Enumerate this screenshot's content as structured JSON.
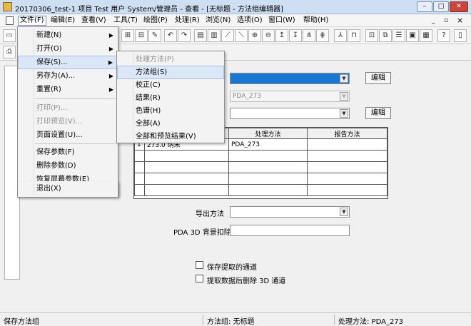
{
  "window": {
    "title": "20170306_test-1 项目 Test 用户 System/管理员 - 查看 - [无标题 - 方法组编辑器]",
    "controls": {
      "minimize": "–",
      "restore": "□",
      "close": "✕"
    },
    "mdi_controls": {
      "minimize": "_",
      "restore": "▫",
      "close": "×"
    }
  },
  "menubar": {
    "items": [
      {
        "label": "文件(F)",
        "active": true
      },
      {
        "label": "编辑(E)"
      },
      {
        "label": "查看(V)"
      },
      {
        "label": "工具(T)"
      },
      {
        "label": "绘图(P)"
      },
      {
        "label": "处理(R)"
      },
      {
        "label": "浏览(N)"
      },
      {
        "label": "选项(O)"
      },
      {
        "label": "窗口(W)"
      },
      {
        "label": "帮助(H)"
      }
    ]
  },
  "file_menu": {
    "items": [
      {
        "label": "新建(N)",
        "submenu": true
      },
      {
        "label": "打开(O)",
        "submenu": true
      },
      {
        "label": "保存(S)...",
        "submenu": true,
        "highlighted": true
      },
      {
        "label": "另存为(A)...",
        "submenu": true
      },
      {
        "label": "重置(R)",
        "submenu": true
      },
      {
        "label": "打印(P)...",
        "disabled": true
      },
      {
        "label": "打印预览(V)...",
        "disabled": true
      },
      {
        "label": "页面设置(U)..."
      },
      {
        "label": "保存参数(F)"
      },
      {
        "label": "删除参数(D)"
      },
      {
        "label": "恢复屏幕参数(E)"
      },
      {
        "label": "退出(X)"
      }
    ],
    "submenu_arrow": "▶"
  },
  "save_submenu": {
    "items": [
      {
        "label": "处理方法(P)",
        "disabled": true
      },
      {
        "label": "方法组(S)",
        "highlighted": true
      },
      {
        "label": "校正(C)"
      },
      {
        "label": "结果(R)"
      },
      {
        "label": "色谱(H)"
      },
      {
        "label": "全部(A)"
      },
      {
        "label": "全部和预览结果(V)"
      }
    ]
  },
  "form": {
    "edit_button_1": "编辑",
    "edit_button_2": "编辑",
    "combo2_value": "PDA_273",
    "combo_arrow": "▼",
    "table": {
      "headers": [
        "",
        "",
        "处理方法",
        "报告方法"
      ],
      "rows": [
        [
          "1",
          "273.0 纳米",
          "PDA_273",
          ""
        ],
        [
          "",
          "",
          "",
          ""
        ],
        [
          "",
          "",
          "",
          ""
        ],
        [
          "",
          "",
          "",
          ""
        ],
        [
          "",
          "",
          "",
          ""
        ]
      ]
    },
    "export_method_label": "导出方法",
    "pda_bg_label": "PDA 3D 背景扣除",
    "checkbox1_label": "保存提取的通道",
    "checkbox2_label": "提取数据后删除 3D 通道"
  },
  "statusbar": {
    "left": "保存方法组",
    "middle": "方法组: 无标题",
    "right": "处理方法: PDA_273"
  },
  "colors": {
    "selected_combo": "#1976d2",
    "menu_highlight": "#dbe7f7",
    "titlebar": "#cfdff3"
  }
}
